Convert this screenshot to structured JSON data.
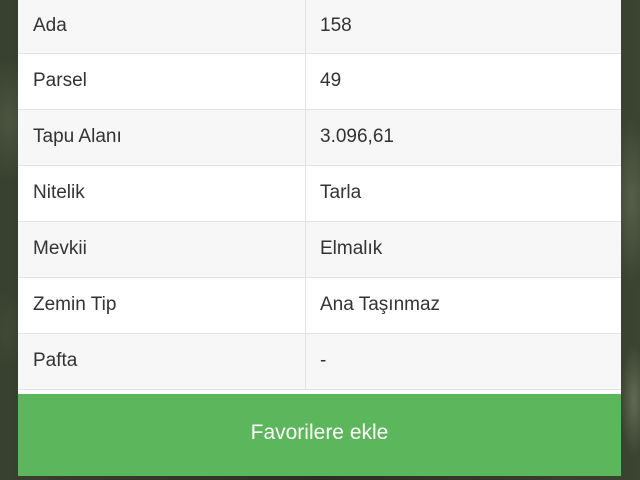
{
  "parcel_info": {
    "rows": [
      {
        "key": "Ada",
        "value": "158"
      },
      {
        "key": "Parsel",
        "value": "49"
      },
      {
        "key": "Tapu Alanı",
        "value": "3.096,61"
      },
      {
        "key": "Nitelik",
        "value": "Tarla"
      },
      {
        "key": "Mevkii",
        "value": "Elmalık"
      },
      {
        "key": "Zemin Tip",
        "value": "Ana Taşınmaz"
      },
      {
        "key": "Pafta",
        "value": "-"
      }
    ]
  },
  "actions": {
    "favorite_label": "Favorilere ekle"
  },
  "colors": {
    "button": "#5cb65c",
    "row_alt": "#f7f7f7",
    "text": "#333333"
  }
}
